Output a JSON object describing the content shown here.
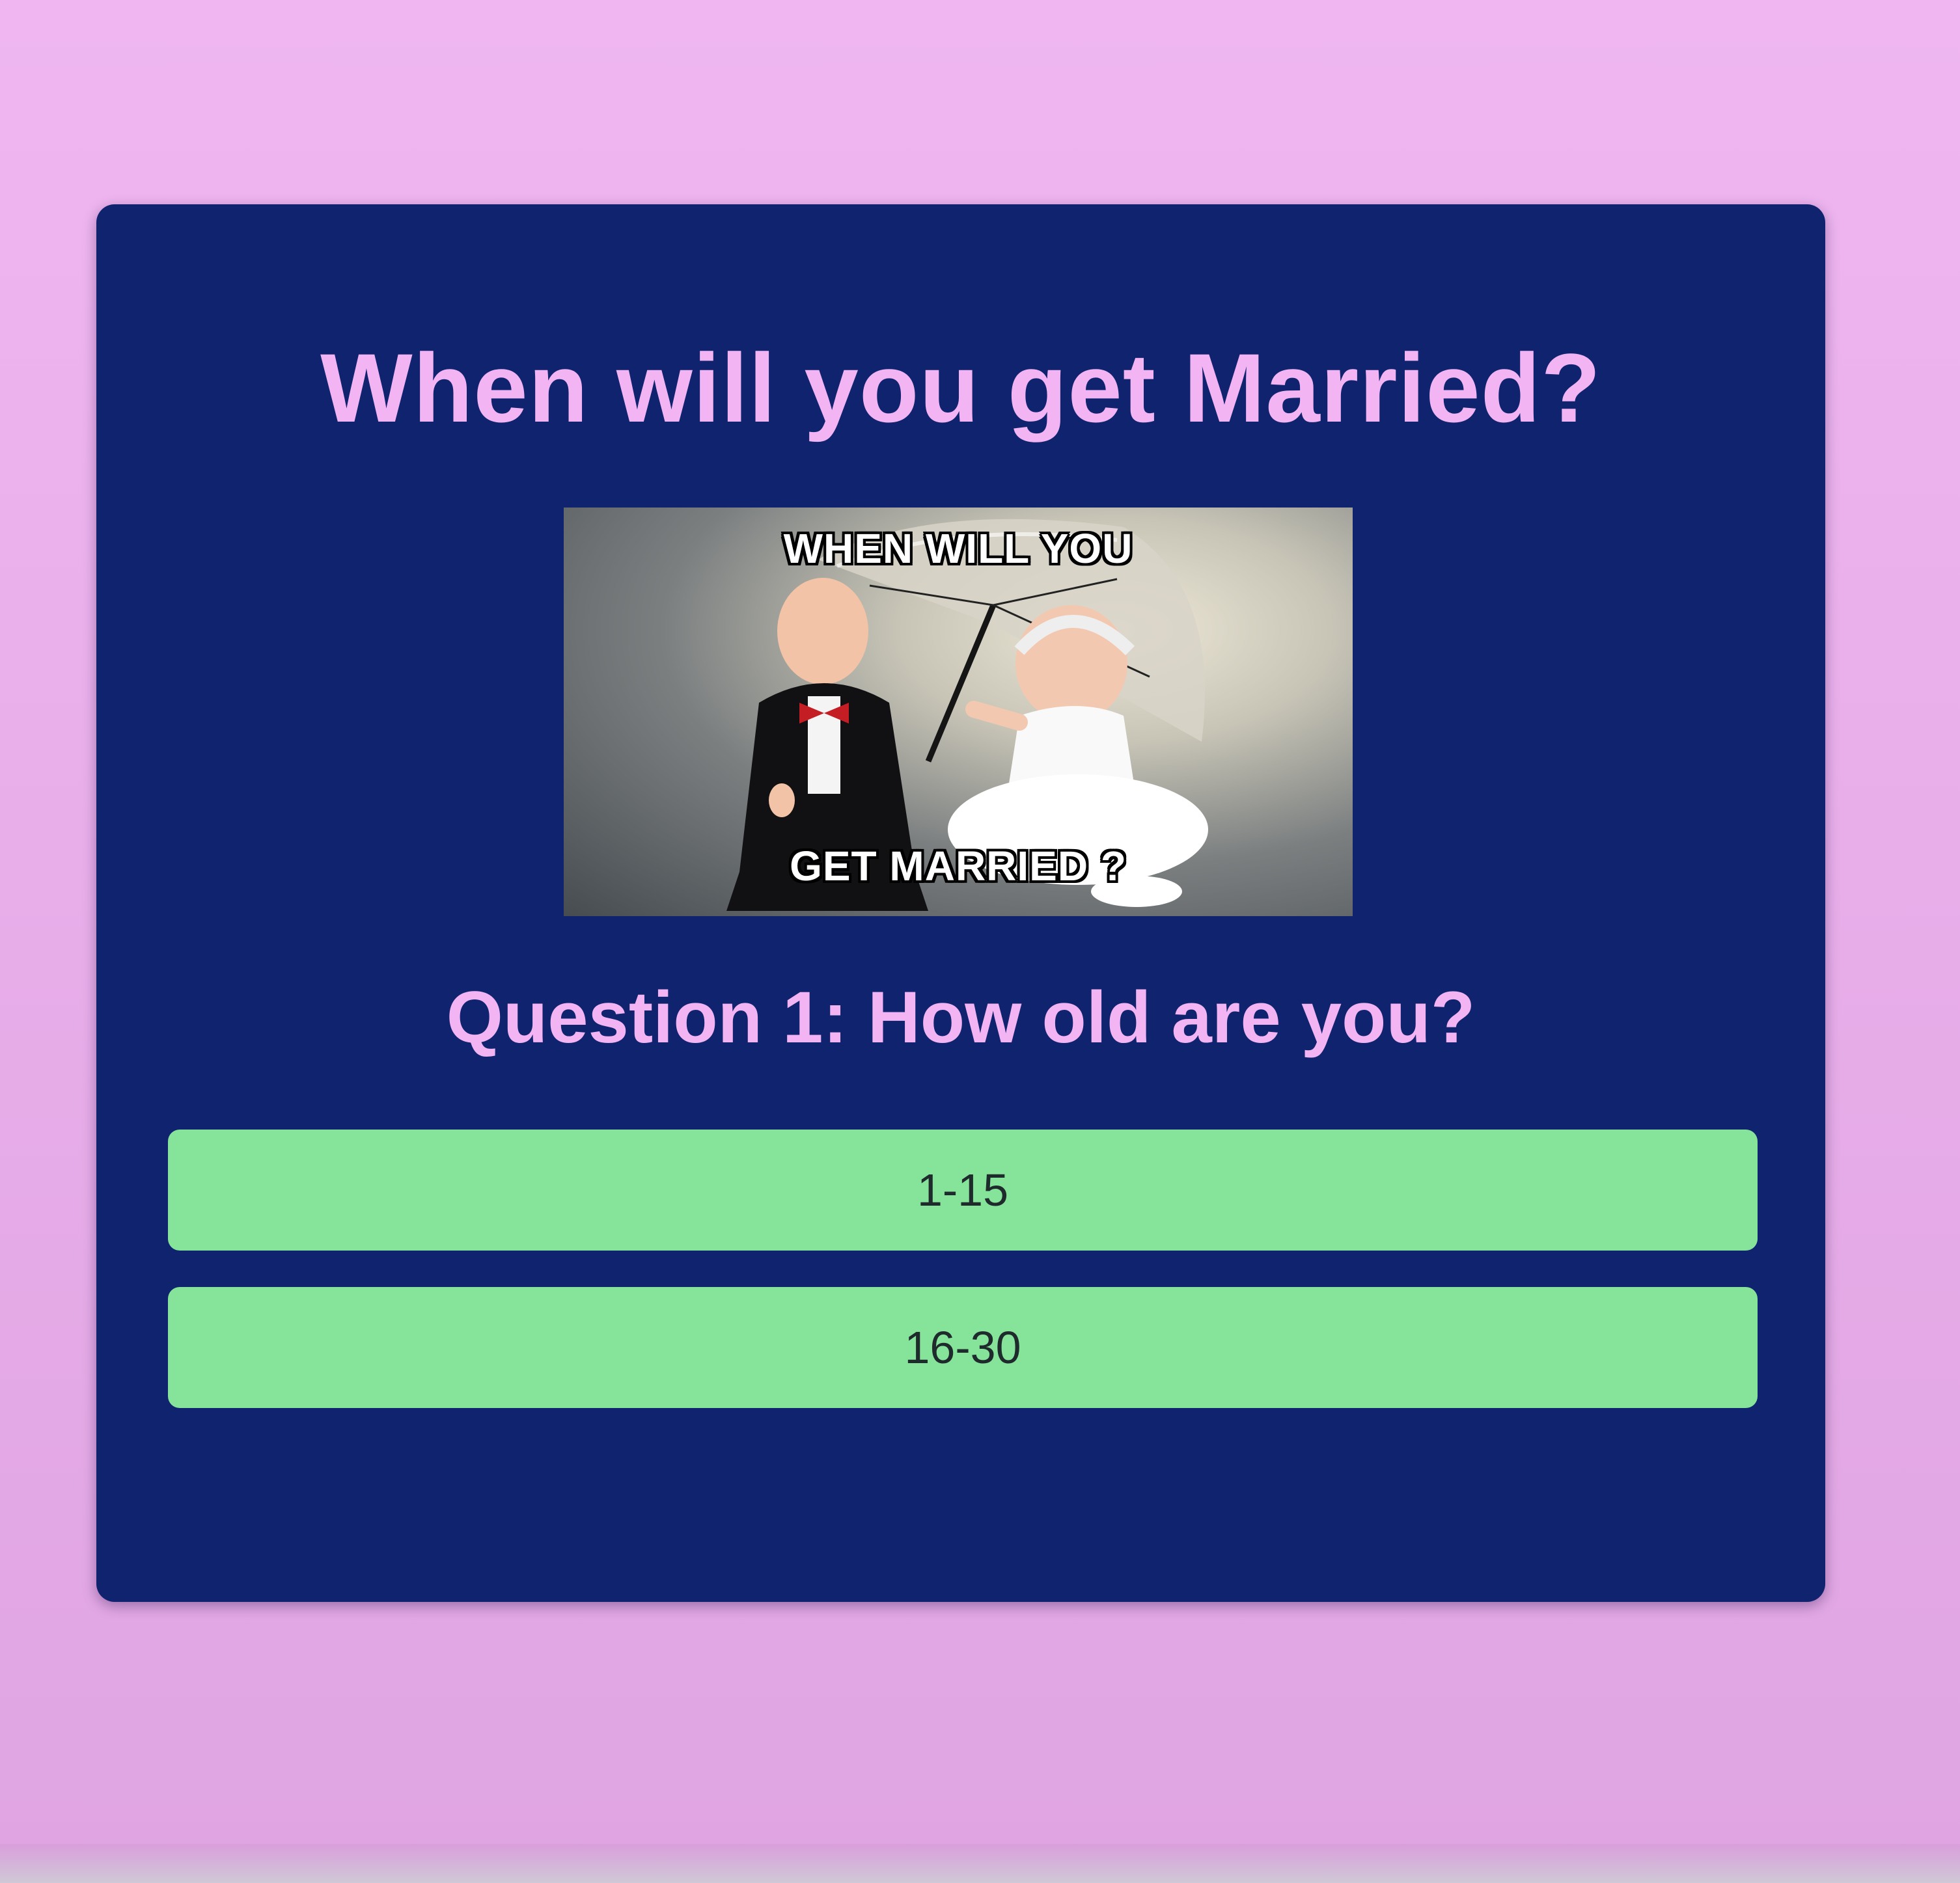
{
  "colors": {
    "page_background": "#efb6f1",
    "card_background": "#10236e",
    "heading_text": "#f2b4f2",
    "answer_button": "#86e49a",
    "answer_text": "#1f2a2c"
  },
  "quiz": {
    "title": "When will you get Married?",
    "image": {
      "caption_top": "WHEN WILL YOU",
      "caption_bottom": "GET MARRIED ?"
    },
    "question": "Question 1: How old are you?",
    "answers": [
      {
        "label": "1-15"
      },
      {
        "label": "16-30"
      }
    ]
  }
}
